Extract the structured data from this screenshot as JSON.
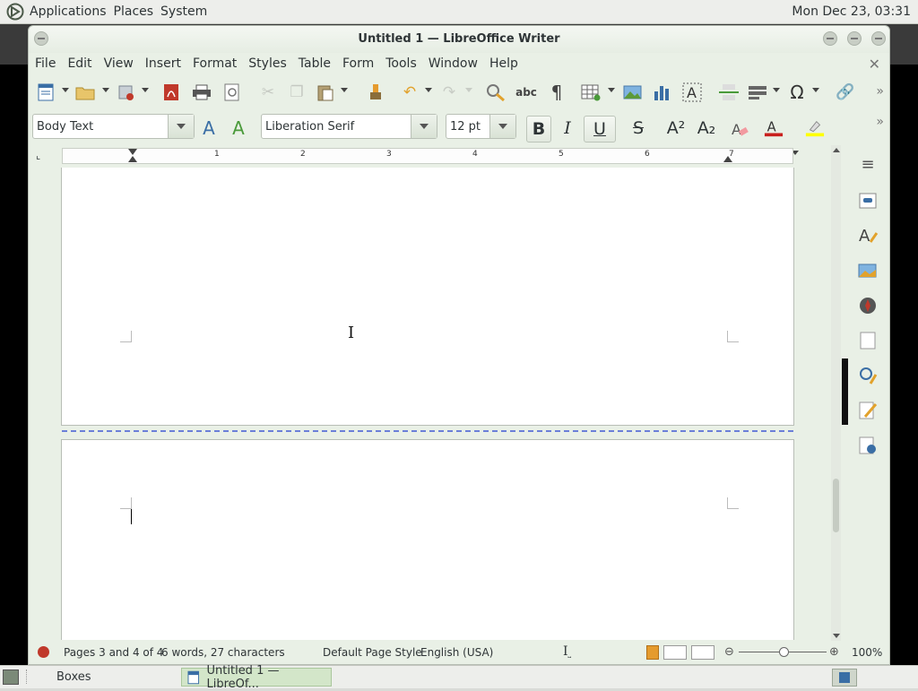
{
  "top_panel": {
    "menus": [
      "Applications",
      "Places",
      "System"
    ],
    "clock": "Mon Dec 23, 03:31"
  },
  "window": {
    "title": "Untitled 1 — LibreOffice Writer",
    "menu": [
      "File",
      "Edit",
      "View",
      "Insert",
      "Format",
      "Styles",
      "Table",
      "Form",
      "Tools",
      "Window",
      "Help"
    ]
  },
  "formatting": {
    "paragraph_style": "Body Text",
    "font_name": "Liberation Serif",
    "font_size": "12 pt",
    "bold_label": "B",
    "italic_label": "I",
    "underline_label": "U",
    "strike_label": "S",
    "superscript_label": "A²",
    "subscript_label": "A₂"
  },
  "ruler": {
    "numbers": [
      "1",
      "2",
      "3",
      "4",
      "5",
      "6",
      "7"
    ]
  },
  "status_bar": {
    "pages": "Pages 3 and 4 of 4",
    "words": "6 words, 27 characters",
    "page_style": "Default Page Style",
    "language": "English (USA)",
    "zoom": "100%"
  },
  "taskbar": {
    "items": [
      "Boxes",
      "Untitled 1 — LibreOf..."
    ]
  },
  "colors": {
    "font_color": "#c9211e",
    "highlight_color": "#ffff00",
    "page_break_line": "#6b7fd8"
  }
}
